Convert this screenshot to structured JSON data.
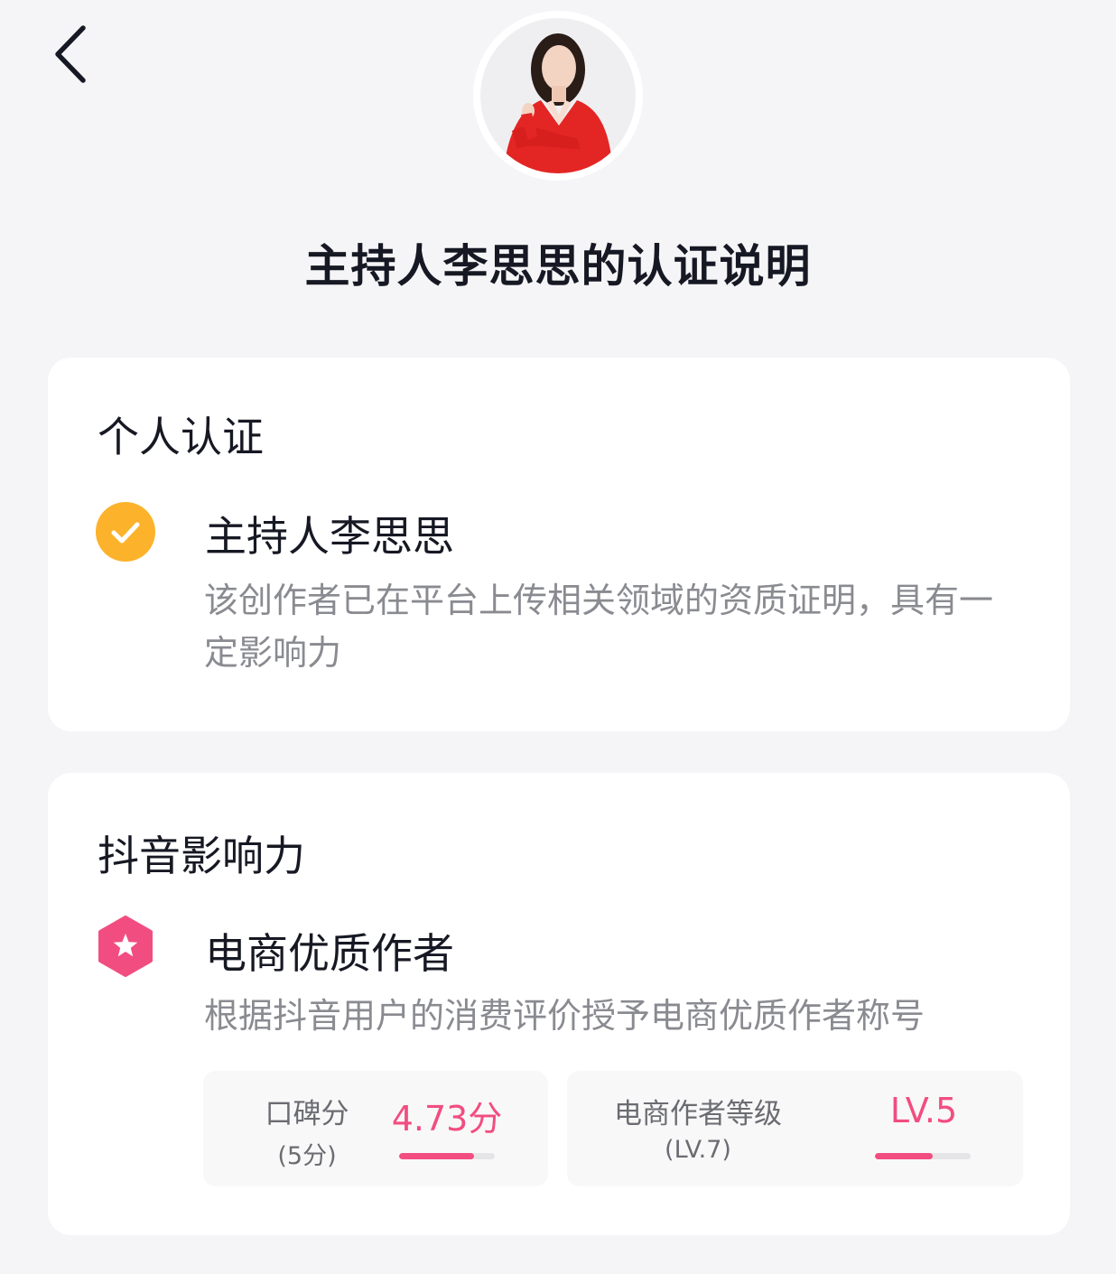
{
  "header": {
    "back_icon": "chevron-left-icon",
    "title": "主持人李思思的认证说明"
  },
  "personal_cert": {
    "heading": "个人认证",
    "item": {
      "icon": "check-circle-icon",
      "icon_color": "#fdb22b",
      "title": "主持人李思思",
      "description": "该创作者已在平台上传相关领域的资质证明，具有一定影响力"
    }
  },
  "douyin_influence": {
    "heading": "抖音影响力",
    "item": {
      "icon": "star-hexagon-icon",
      "icon_color": "#f24d80",
      "title": "电商优质作者",
      "description": "根据抖音用户的消费评价授予电商优质作者称号"
    },
    "stats": [
      {
        "label": "口碑分",
        "sub": "(5分)",
        "value": "4.73分",
        "progress": 0.78
      },
      {
        "label": "电商作者等级",
        "sub": "(LV.7)",
        "value": "LV.5",
        "progress": 0.6
      }
    ]
  },
  "colors": {
    "accent": "#f24d80",
    "background": "#f5f5f7",
    "card": "#ffffff",
    "muted_text": "#8a8b91"
  }
}
